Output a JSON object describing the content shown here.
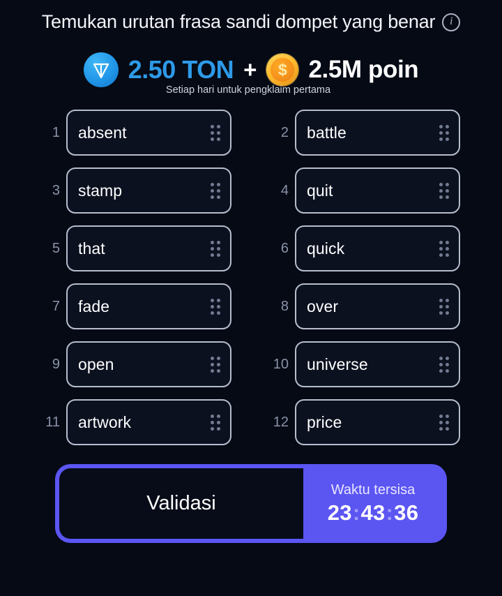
{
  "header": {
    "title": "Temukan urutan frasa sandi dompet yang benar",
    "info_icon": "info-icon",
    "info_icon_glyph": "i"
  },
  "reward": {
    "ton_icon": "ton-coin-icon",
    "ton_amount": "2.50 TON",
    "plus": "+",
    "coin_icon": "points-coin-icon",
    "coin_glyph": "$",
    "points_amount": "2.5M poin",
    "note": "Setiap hari untuk pengklaim pertama",
    "ton_color": "#2e9ae8",
    "coin_color": "#ffbc2e"
  },
  "seed_phrase": {
    "words": [
      {
        "index": "1",
        "word": "absent"
      },
      {
        "index": "2",
        "word": "battle"
      },
      {
        "index": "3",
        "word": "stamp"
      },
      {
        "index": "4",
        "word": "quit"
      },
      {
        "index": "5",
        "word": "that"
      },
      {
        "index": "6",
        "word": "quick"
      },
      {
        "index": "7",
        "word": "fade"
      },
      {
        "index": "8",
        "word": "over"
      },
      {
        "index": "9",
        "word": "open"
      },
      {
        "index": "10",
        "word": "universe"
      },
      {
        "index": "11",
        "word": "artwork"
      },
      {
        "index": "12",
        "word": "price"
      }
    ]
  },
  "action_bar": {
    "validate_label": "Validasi",
    "timer_label": "Waktu tersisa",
    "timer_hours": "23",
    "timer_minutes": "43",
    "timer_seconds": "36",
    "timer_separator": ":",
    "accent_color": "#5b55f2"
  }
}
